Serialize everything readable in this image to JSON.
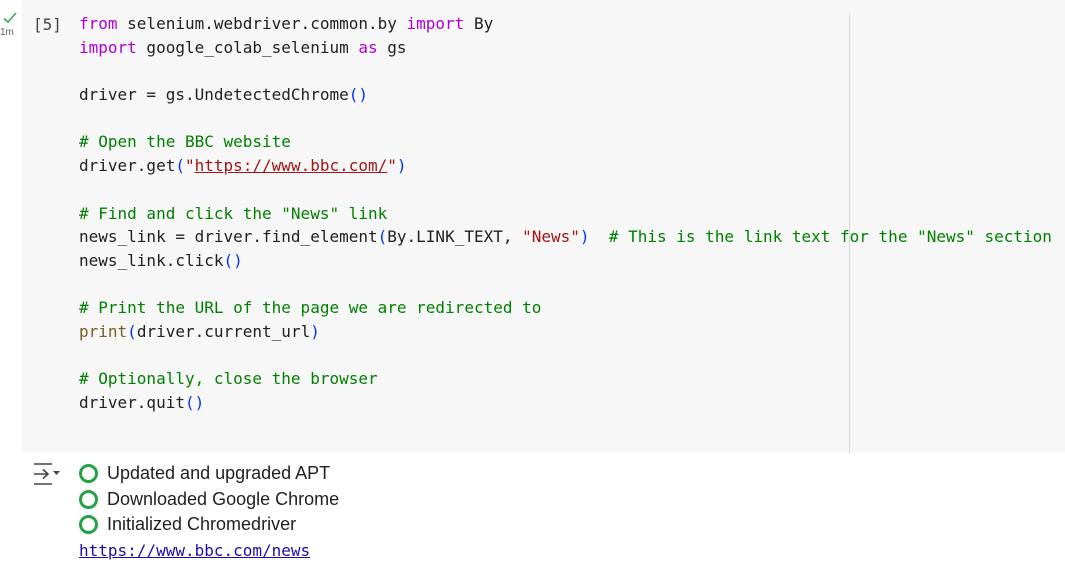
{
  "gutter": {
    "run_time": "1m"
  },
  "cell": {
    "execution_count": "[5]",
    "code_lines": [
      [
        {
          "t": "from",
          "c": "kw"
        },
        {
          "t": " selenium.webdriver.common.by "
        },
        {
          "t": "import",
          "c": "kw"
        },
        {
          "t": " By"
        }
      ],
      [
        {
          "t": "import",
          "c": "kw"
        },
        {
          "t": " google_colab_selenium "
        },
        {
          "t": "as",
          "c": "kw"
        },
        {
          "t": " gs"
        }
      ],
      [],
      [
        {
          "t": "driver = gs.UndetectedChrome"
        },
        {
          "t": "()",
          "c": "pn"
        }
      ],
      [],
      [
        {
          "t": "# Open the BBC website",
          "c": "cm"
        }
      ],
      [
        {
          "t": "driver.get"
        },
        {
          "t": "(",
          "c": "pn"
        },
        {
          "t": "\"",
          "c": "st"
        },
        {
          "t": "https://www.bbc.com/",
          "c": "st url"
        },
        {
          "t": "\"",
          "c": "st"
        },
        {
          "t": ")",
          "c": "pn"
        }
      ],
      [],
      [
        {
          "t": "# Find and click the \"News\" link",
          "c": "cm"
        }
      ],
      [
        {
          "t": "news_link = driver.find_element"
        },
        {
          "t": "(",
          "c": "pn"
        },
        {
          "t": "By.LINK_TEXT, "
        },
        {
          "t": "\"News\"",
          "c": "st"
        },
        {
          "t": ")",
          "c": "pn"
        },
        {
          "t": "  "
        },
        {
          "t": "# This is the link text for the \"News\" section",
          "c": "cm"
        }
      ],
      [
        {
          "t": "news_link.click"
        },
        {
          "t": "()",
          "c": "pn"
        }
      ],
      [],
      [
        {
          "t": "# Print the URL of the page we are redirected to",
          "c": "cm"
        }
      ],
      [
        {
          "t": "print",
          "c": "bi"
        },
        {
          "t": "(",
          "c": "pn"
        },
        {
          "t": "driver.current_url"
        },
        {
          "t": ")",
          "c": "pn"
        }
      ],
      [],
      [
        {
          "t": "# Optionally, close the browser",
          "c": "cm"
        }
      ],
      [
        {
          "t": "driver.quit"
        },
        {
          "t": "()",
          "c": "pn"
        }
      ]
    ]
  },
  "output": {
    "status_lines": [
      "Updated and upgraded APT",
      "Downloaded Google Chrome",
      "Initialized Chromedriver"
    ],
    "link_text": "https://www.bbc.com/news"
  }
}
